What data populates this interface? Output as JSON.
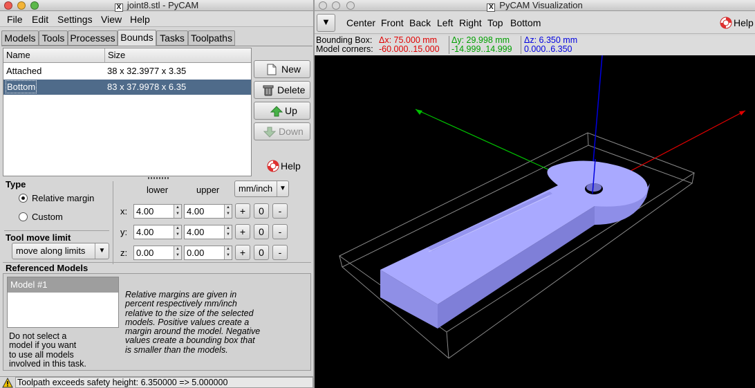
{
  "left_window": {
    "title": "joint8.stl - PyCAM",
    "menu": [
      "File",
      "Edit",
      "Settings",
      "View",
      "Help"
    ],
    "tabs": [
      "Models",
      "Tools",
      "Processes",
      "Bounds",
      "Tasks",
      "Toolpaths"
    ],
    "active_tab": "Bounds",
    "bounds_table": {
      "columns": [
        "Name",
        "Size"
      ],
      "rows": [
        {
          "name": "Attached",
          "size": "38 x 32.3977 x 3.35",
          "selected": false
        },
        {
          "name": "Bottom",
          "size": "83 x 37.9978 x 6.35",
          "selected": true
        }
      ]
    },
    "buttons": {
      "new": "New",
      "delete": "Delete",
      "up": "Up",
      "down": "Down",
      "help": "Help"
    },
    "type_section": {
      "title": "Type",
      "options": [
        "Relative margin",
        "Custom"
      ],
      "selected": "Relative margin"
    },
    "margins": {
      "lower_label": "lower",
      "upper_label": "upper",
      "unit": "mm/inch",
      "rows": [
        {
          "axis": "x:",
          "lower": "4.00",
          "upper": "4.00"
        },
        {
          "axis": "y:",
          "lower": "4.00",
          "upper": "4.00"
        },
        {
          "axis": "z:",
          "lower": "0.00",
          "upper": "0.00"
        }
      ],
      "plus": "+",
      "zero": "0",
      "minus": "-"
    },
    "tool_move": {
      "title": "Tool move limit",
      "value": "move along limits"
    },
    "referenced_models": {
      "title": "Referenced Models",
      "items": [
        "Model #1"
      ],
      "hint_lines": [
        "Do not select a",
        "model if you want",
        "to use all models",
        "involved in this task."
      ],
      "description_lines": [
        "Relative margins are given in",
        "percent respectively mm/inch",
        "relative to the size of the selected",
        "models. Positive values create a",
        "margin around the model. Negative",
        "values create a bounding box that",
        "is smaller than the models."
      ]
    },
    "status": "Toolpath exceeds safety height: 6.350000 => 5.000000"
  },
  "right_window": {
    "title": "PyCAM Visualization",
    "views": [
      "Center",
      "Front",
      "Back",
      "Left",
      "Right",
      "Top",
      "Bottom"
    ],
    "help": "Help",
    "bounding_box_label": "Bounding Box:",
    "model_corners_label": "Model corners:",
    "dx": "Δx: 75.000 mm",
    "dy": "Δy: 29.998 mm",
    "dz": "Δz: 6.350 mm",
    "cx": "-60.000..15.000",
    "cy": "-14.999..14.999",
    "cz": "0.000..6.350",
    "colors": {
      "x": "#e00000",
      "y": "#00b000",
      "z": "#0000e0",
      "model": "#a9a9ff"
    }
  }
}
